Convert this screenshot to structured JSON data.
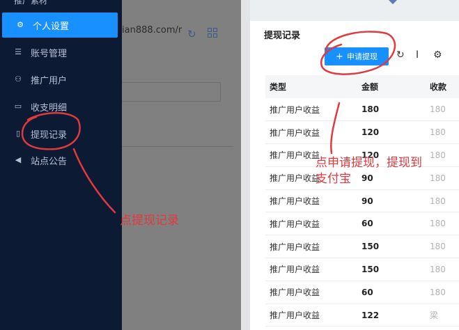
{
  "left": {
    "menu_top_partial": "推广素材",
    "menu": [
      {
        "label": "个人设置",
        "icon": "gear-icon",
        "glyph": "⚙",
        "active": true
      },
      {
        "label": "账号管理",
        "icon": "list-icon",
        "glyph": "☰",
        "active": false
      },
      {
        "label": "推广用户",
        "icon": "users-icon",
        "glyph": "⚇",
        "active": false
      },
      {
        "label": "收支明细",
        "icon": "bill-icon",
        "glyph": "▭",
        "active": false
      },
      {
        "label": "提现记录",
        "icon": "record-icon",
        "glyph": "▯",
        "active": false
      },
      {
        "label": "站点公告",
        "icon": "megaphone-icon",
        "glyph": "◀",
        "active": false
      }
    ],
    "url_fragment": "ian888.com/r",
    "annotation": "点提现记录"
  },
  "right": {
    "card_title": "提现记录",
    "apply_button": "申请提现",
    "columns": [
      "类型",
      "金额",
      "收款"
    ],
    "rows": [
      {
        "type": "推广用户收益",
        "amount": "180",
        "extra": "180"
      },
      {
        "type": "推广用户收益",
        "amount": "120",
        "extra": "180"
      },
      {
        "type": "推广用户收益",
        "amount": "120",
        "extra": "180"
      },
      {
        "type": "推广用户收益",
        "amount": "90",
        "extra": "180"
      },
      {
        "type": "推广用户收益",
        "amount": "90",
        "extra": "180"
      },
      {
        "type": "推广用户收益",
        "amount": "60",
        "extra": "180"
      },
      {
        "type": "推广用户收益",
        "amount": "150",
        "extra": "180"
      },
      {
        "type": "推广用户收益",
        "amount": "150",
        "extra": "180"
      },
      {
        "type": "推广用户收益",
        "amount": "60",
        "extra": "180"
      },
      {
        "type": "推广用户收益",
        "amount": "122",
        "extra": "梁"
      }
    ],
    "annotation_line1": "点申请提现，提现到",
    "annotation_line2": "支付宝"
  },
  "colors": {
    "sidebar": "#0d1a33",
    "accent": "#1890ff",
    "annotation": "#e0393e"
  }
}
